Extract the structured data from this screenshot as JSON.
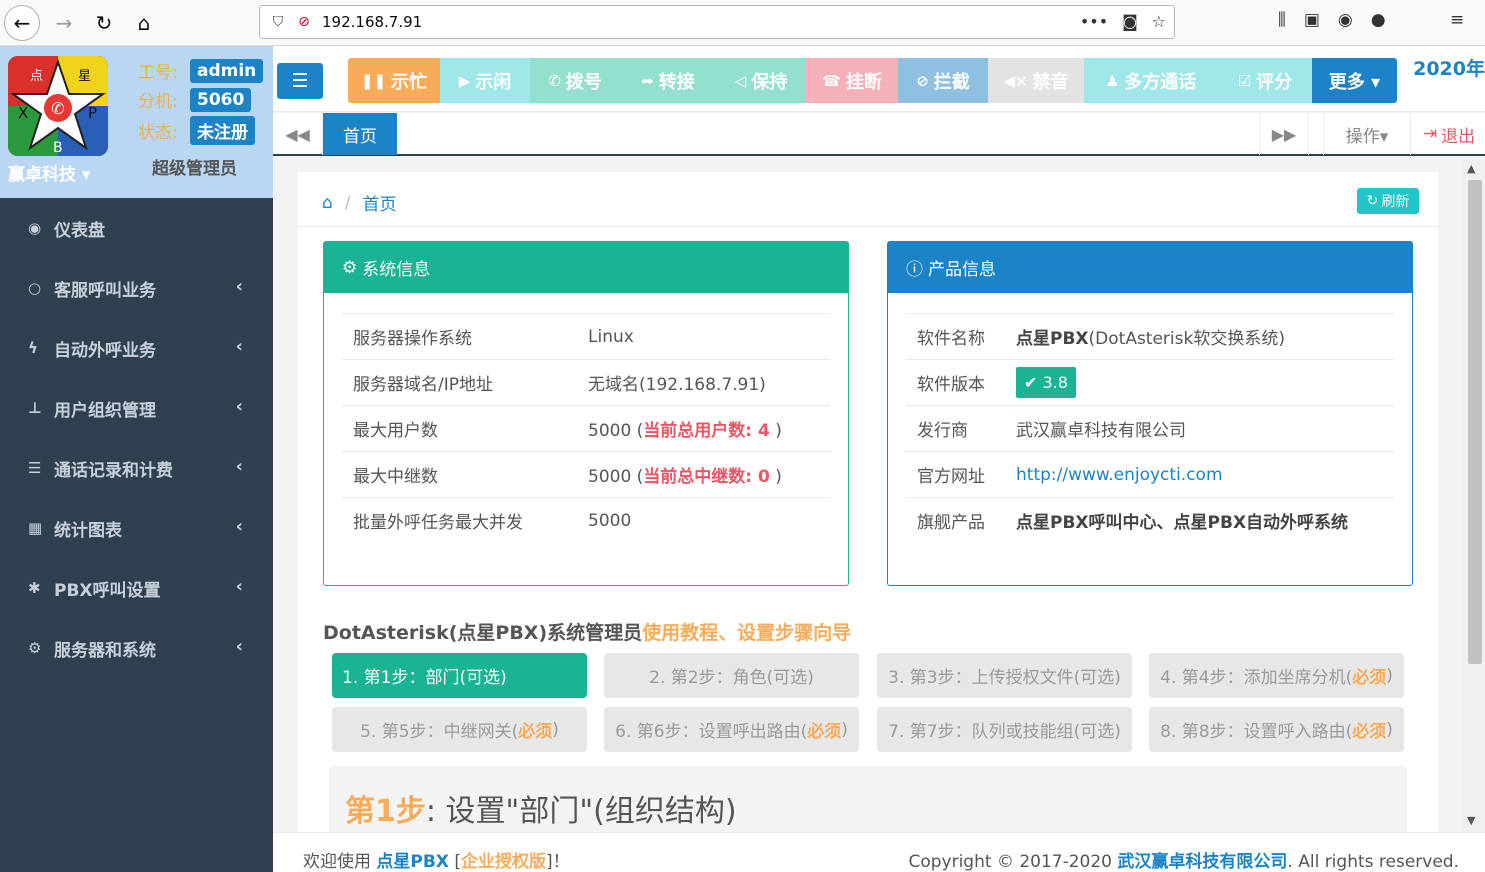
{
  "browser": {
    "url": "192.168.7.91"
  },
  "profile": {
    "org": "赢卓科技 ▾",
    "role": "超级管理员",
    "rows": [
      {
        "key": "工号:",
        "value": "admin"
      },
      {
        "key": "分机:",
        "value": "5060"
      },
      {
        "key": "状态:",
        "value": "未注册"
      }
    ],
    "logo_letters": {
      "top_left": "点",
      "top_right": "星",
      "left": "X",
      "right": "P",
      "bottom": "B"
    }
  },
  "menu": [
    {
      "label": "仪表盘",
      "icon": "dashboard-icon",
      "glyph": "◉",
      "chevron": false
    },
    {
      "label": "客服呼叫业务",
      "icon": "phone-icon",
      "glyph": "○",
      "chevron": true
    },
    {
      "label": "自动外呼业务",
      "icon": "bolt-icon",
      "glyph": "ϟ",
      "chevron": true
    },
    {
      "label": "用户组织管理",
      "icon": "sitemap-icon",
      "glyph": "⊥",
      "chevron": true
    },
    {
      "label": "通话记录和计费",
      "icon": "list-icon",
      "glyph": "☰",
      "chevron": true
    },
    {
      "label": "统计图表",
      "icon": "table-icon",
      "glyph": "▦",
      "chevron": true
    },
    {
      "label": "PBX呼叫设置",
      "icon": "asterisk-icon",
      "glyph": "✱",
      "chevron": true
    },
    {
      "label": "服务器和系统",
      "icon": "cogs-icon",
      "glyph": "⚙",
      "chevron": true
    }
  ],
  "toolbar": {
    "ops": [
      {
        "label": "示忙",
        "icon": "pause-icon",
        "glyph": "❚❚",
        "color": "#f8ac59",
        "width": 92
      },
      {
        "label": "示闲",
        "icon": "play-icon",
        "glyph": "▶",
        "color": "#9fe7e8",
        "width": 90
      },
      {
        "label": "拨号",
        "icon": "phone-icon",
        "glyph": "✆",
        "color": "#94e0cf",
        "width": 90
      },
      {
        "label": "转接",
        "icon": "share-icon",
        "glyph": "➦",
        "color": "#94e0cf",
        "width": 96
      },
      {
        "label": "保持",
        "icon": "bullhorn-icon",
        "glyph": "◁",
        "color": "#94e0cf",
        "width": 90
      },
      {
        "label": "挂断",
        "icon": "hangup-icon",
        "glyph": "☎",
        "color": "#f6b0b8",
        "width": 92
      },
      {
        "label": "拦截",
        "icon": "ban-icon",
        "glyph": "⊘",
        "color": "#8fc0e2",
        "width": 90
      },
      {
        "label": "禁音",
        "icon": "mute-icon",
        "glyph": "◀×",
        "color": "#e3e3e3",
        "width": 96
      },
      {
        "label": "多方通话",
        "icon": "users-icon",
        "glyph": "♟",
        "color": "#9fe7e8",
        "width": 134
      },
      {
        "label": "评分",
        "icon": "check-icon",
        "glyph": "☑",
        "color": "#9fe7e8",
        "width": 94
      },
      {
        "label": "更多 ▾",
        "icon": "",
        "glyph": "",
        "color": "#1c84c6",
        "width": 85
      }
    ],
    "year": "2020年"
  },
  "tabs": {
    "home": "首页",
    "ops": "操作▾",
    "logout": "退出"
  },
  "breadcrumb": {
    "current": "首页",
    "refresh": "刷新"
  },
  "system_info": {
    "title": "系统信息",
    "rows": [
      {
        "k": "服务器操作系统",
        "v": "Linux"
      },
      {
        "k": "服务器域名/IP地址",
        "v": "无域名(192.168.7.91)"
      },
      {
        "k": "最大用户数",
        "v": "5000",
        "extra_label": "当前总用户数: 4"
      },
      {
        "k": "最大中继数",
        "v": "5000",
        "extra_label": "当前总中继数: 0"
      },
      {
        "k": "批量外呼任务最大并发",
        "v": "5000"
      }
    ]
  },
  "product_info": {
    "title": "产品信息",
    "name_k": "软件名称",
    "name_bold": "点星PBX",
    "name_rest": "(DotAsterisk软交换系统)",
    "version_k": "软件版本",
    "version_v": "3.8",
    "publisher_k": "发行商",
    "publisher_v": "武汉赢卓科技有限公司",
    "site_k": "官方网址",
    "site_v": "http://www.enjoycti.com",
    "flagship_k": "旗舰产品",
    "flagship_v": "点星PBX呼叫中心、点星PBX自动外呼系统"
  },
  "guide": {
    "title": "DotAsterisk(点星PBX)系统管理员",
    "title_orange": "使用教程、设置步骤向导",
    "steps": [
      {
        "text": "1. 第1步：部门(可选)",
        "req": ""
      },
      {
        "text": "2. 第2步：角色(可选)",
        "req": ""
      },
      {
        "text": "3. 第3步：上传授权文件(可选)",
        "req": ""
      },
      {
        "text": "4. 第4步：添加坐席分机(",
        "req": "必须"
      },
      {
        "text": "5. 第5步：中继网关(",
        "req": "必须"
      },
      {
        "text": "6. 第6步：设置呼出路由(",
        "req": "必须"
      },
      {
        "text": "7. 第7步：队列或技能组(可选)",
        "req": ""
      },
      {
        "text": "8. 第8步：设置呼入路由(",
        "req": "必须"
      }
    ],
    "box_num": "第1步",
    "box_text": ": 设置\"部门\"(组织结构)"
  },
  "footer": {
    "welcome": "欢迎使用 ",
    "product": "点星PBX",
    "lb": " [",
    "edition": "企业授权版",
    "rb": "]！",
    "copyright": "Copyright © 2017-2020 ",
    "company": "武汉赢卓科技有限公司",
    "rights": ". All rights reserved."
  }
}
